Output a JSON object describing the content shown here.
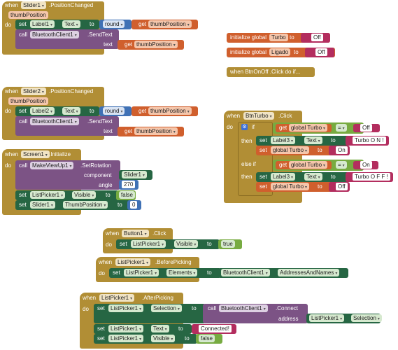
{
  "kw": {
    "when": "when",
    "do": "do",
    "call": "call",
    "set": "set",
    "to": "to",
    "get": "get",
    "text": "text",
    "if": "if",
    "then": "then",
    "else_if": "else if",
    "initialize_global": "initialize global",
    "component": "component",
    "angle": "angle",
    "address": "address",
    "round": "round",
    "equals": "="
  },
  "slider1_event": {
    "component": "Slider1",
    "event": ".PositionChanged",
    "param": "thumbPosition",
    "set_component": "Label1",
    "set_prop": "Text",
    "get_var": "thumbPosition",
    "call_component": "BluetoothClient1",
    "call_method": ".SendText",
    "text_var": "thumbPosition"
  },
  "slider2_event": {
    "component": "Slider2",
    "event": ".PositionChanged",
    "param": "thumbPosition",
    "set_component": "Label2",
    "set_prop": "Text",
    "get_var": "thumbPosition",
    "call_component": "BluetoothClient1",
    "call_method": ".SendText",
    "text_var": "thumbPosition"
  },
  "globals": [
    {
      "name": "Turbo",
      "value": "Off"
    },
    {
      "name": "Ligado",
      "value": "Off"
    }
  ],
  "collapsed_block": "when  BtnOnOff .Click do if...",
  "screen_init": {
    "component": "Screen1",
    "event": ".Initialize",
    "call_component": "MakeViewUp1",
    "call_method": ".SetRotation",
    "component_arg": "Slider1",
    "angle_arg": "270",
    "set1_component": "ListPicker1",
    "set1_prop": "Visible",
    "set1_value": "false",
    "set2_component": "Slider1",
    "set2_prop": "ThumbPosition",
    "set2_value": "0"
  },
  "btnturbo": {
    "component": "BtnTurbo",
    "event": ".Click",
    "cond1_var": "global Turbo",
    "cond1_value": "Off",
    "then1_component": "Label3",
    "then1_prop": "Text",
    "then1_value": "Turbo O N !",
    "then1b_var": "global Turbo",
    "then1b_value": "On",
    "cond2_var": "global Turbo",
    "cond2_value": "On",
    "then2_component": "Label3",
    "then2_prop": "Text",
    "then2_value": "Turbo O F F !",
    "then2b_var": "global Turbo",
    "then2b_value": "Off"
  },
  "button1": {
    "component": "Button1",
    "event": ".Click",
    "set_component": "ListPicker1",
    "set_prop": "Visible",
    "set_value": "true"
  },
  "lp_before": {
    "component": "ListPicker1",
    "event": ".BeforePicking",
    "set_component": "ListPicker1",
    "set_prop": "Elements",
    "value_component": "BluetoothClient1",
    "value_prop": "AddressesAndNames"
  },
  "lp_after": {
    "component": "ListPicker1",
    "event": ".AfterPicking",
    "set1_component": "ListPicker1",
    "set1_prop": "Selection",
    "call_component": "BluetoothClient1",
    "call_method": ".Connect",
    "addr_component": "ListPicker1",
    "addr_prop": "Selection",
    "set2_component": "ListPicker1",
    "set2_prop": "Text",
    "set2_value": "Connected!",
    "set3_component": "ListPicker1",
    "set3_prop": "Visible",
    "set3_value": "false"
  },
  "colors": {
    "event": "#b18e35",
    "procedure": "#7c5385",
    "setter": "#266643",
    "math": "#3f71b5",
    "global_var": "#d05f2d",
    "text": "#b32d5e",
    "logic": "#77ab41"
  }
}
